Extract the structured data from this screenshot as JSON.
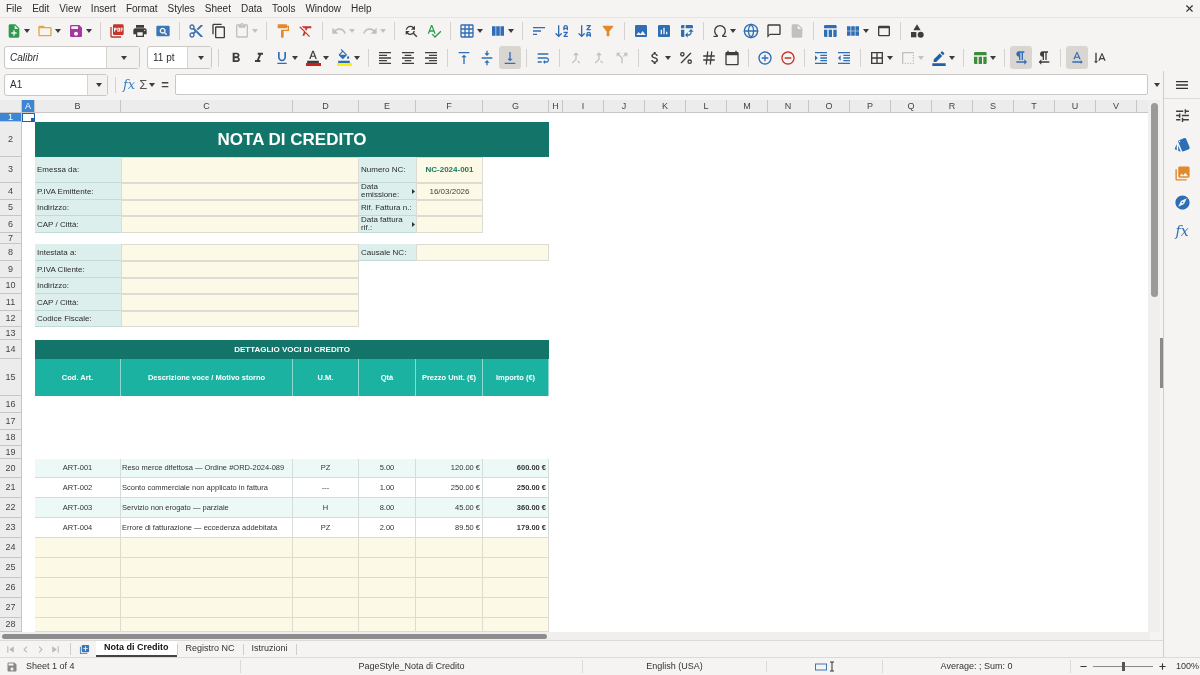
{
  "menu_bar": {
    "items": [
      "File",
      "Edit",
      "View",
      "Insert",
      "Format",
      "Styles",
      "Sheet",
      "Data",
      "Tools",
      "Window",
      "Help"
    ]
  },
  "standard_toolbar": {
    "groups": [
      [
        {
          "kind": "new",
          "disabled": false
        },
        {
          "kind": "open",
          "disabled": false
        },
        {
          "kind": "save",
          "disabled": false
        }
      ],
      [
        {
          "kind": "pdf",
          "disabled": false
        },
        {
          "kind": "print",
          "disabled": false
        },
        {
          "kind": "preview",
          "disabled": false
        }
      ],
      [
        {
          "kind": "cut",
          "disabled": false
        },
        {
          "kind": "copy",
          "disabled": false
        },
        {
          "kind": "paste",
          "disabled": true
        }
      ],
      [
        {
          "kind": "clone",
          "disabled": false
        },
        {
          "kind": "clear",
          "disabled": false
        }
      ],
      [
        {
          "kind": "undo",
          "disabled": true
        },
        {
          "kind": "redo",
          "disabled": true
        }
      ],
      [
        {
          "kind": "find",
          "disabled": false
        },
        {
          "kind": "spelling",
          "disabled": false
        }
      ],
      [
        {
          "kind": "row",
          "disabled": false
        },
        {
          "kind": "column",
          "disabled": false
        }
      ],
      [
        {
          "kind": "sort",
          "disabled": false
        },
        {
          "kind": "ascending",
          "disabled": false
        },
        {
          "kind": "descending",
          "disabled": false
        },
        {
          "kind": "autofilter",
          "disabled": false
        }
      ],
      [
        {
          "kind": "image",
          "disabled": false
        },
        {
          "kind": "chart",
          "disabled": false
        },
        {
          "kind": "pivot",
          "disabled": false
        }
      ],
      [
        {
          "kind": "special",
          "disabled": false
        },
        {
          "kind": "hyperlink",
          "disabled": false
        },
        {
          "kind": "comment",
          "disabled": false
        },
        {
          "kind": "headers",
          "disabled": true
        }
      ],
      [
        {
          "kind": "printarea",
          "disabled": false
        },
        {
          "kind": "freeze",
          "disabled": false
        },
        {
          "kind": "split",
          "disabled": false
        }
      ],
      [
        {
          "kind": "draw",
          "disabled": false
        }
      ]
    ]
  },
  "formatting_toolbar": {
    "font_name": "Calibri",
    "font_size": "11 pt",
    "groups": [
      [
        {
          "kind": "bold",
          "on": false,
          "disabled": false
        },
        {
          "kind": "italic",
          "on": false,
          "disabled": false
        },
        {
          "kind": "underline",
          "on": false,
          "disabled": false
        },
        {
          "kind": "fontcolor",
          "on": false,
          "disabled": false
        },
        {
          "kind": "highlight",
          "on": false,
          "disabled": false
        }
      ],
      [
        {
          "kind": "left",
          "on": false,
          "disabled": false
        },
        {
          "kind": "center",
          "on": false,
          "disabled": false
        },
        {
          "kind": "right",
          "on": false,
          "disabled": false
        }
      ],
      [
        {
          "kind": "top",
          "on": false,
          "disabled": false
        },
        {
          "kind": "middle",
          "on": false,
          "disabled": false
        },
        {
          "kind": "bottom",
          "on": true,
          "disabled": false
        }
      ],
      [
        {
          "kind": "wrap",
          "on": false,
          "disabled": false
        }
      ],
      [
        {
          "kind": "mergecenter",
          "on": false,
          "disabled": true
        },
        {
          "kind": "merge",
          "on": false,
          "disabled": true
        },
        {
          "kind": "unmerge",
          "on": false,
          "disabled": true
        }
      ],
      [
        {
          "kind": "currency",
          "on": false,
          "disabled": false
        },
        {
          "kind": "percent",
          "on": false,
          "disabled": false
        },
        {
          "kind": "number",
          "on": false,
          "disabled": false
        },
        {
          "kind": "date",
          "on": false,
          "disabled": false
        }
      ],
      [
        {
          "kind": "adddecimal",
          "on": false,
          "disabled": false
        },
        {
          "kind": "deletedecimal",
          "on": false,
          "disabled": false
        }
      ],
      [
        {
          "kind": "indent",
          "on": false,
          "disabled": false
        },
        {
          "kind": "outdent",
          "on": false,
          "disabled": false
        }
      ],
      [
        {
          "kind": "borders",
          "on": false,
          "disabled": false
        },
        {
          "kind": "borderstyle",
          "on": false,
          "disabled": true
        },
        {
          "kind": "bordercolor",
          "on": false,
          "disabled": false
        }
      ],
      [
        {
          "kind": "conditional",
          "on": false,
          "disabled": false
        }
      ],
      [
        {
          "kind": "ltr",
          "on": true,
          "disabled": false
        },
        {
          "kind": "rtl",
          "on": false,
          "disabled": false
        }
      ],
      [
        {
          "kind": "horizontal",
          "on": true,
          "disabled": false
        },
        {
          "kind": "vertical",
          "on": false,
          "disabled": false
        }
      ]
    ]
  },
  "formula_bar": {
    "cell_reference": "A1",
    "function_wizard": "fx",
    "sum": "Σ",
    "equals": "="
  },
  "sheet": {
    "column_headers": [
      {
        "label": "A",
        "selected": true
      },
      {
        "label": "B",
        "selected": false
      },
      {
        "label": "C",
        "selected": false
      },
      {
        "label": "D",
        "selected": false
      },
      {
        "label": "E",
        "selected": false
      },
      {
        "label": "F",
        "selected": false
      },
      {
        "label": "G",
        "selected": false
      },
      {
        "label": "H",
        "selected": false
      },
      {
        "label": "I",
        "selected": false
      },
      {
        "label": "J",
        "selected": false
      },
      {
        "label": "K",
        "selected": false
      },
      {
        "label": "L",
        "selected": false
      },
      {
        "label": "M",
        "selected": false
      },
      {
        "label": "N",
        "selected": false
      },
      {
        "label": "O",
        "selected": false
      },
      {
        "label": "P",
        "selected": false
      },
      {
        "label": "Q",
        "selected": false
      },
      {
        "label": "R",
        "selected": false
      },
      {
        "label": "S",
        "selected": false
      },
      {
        "label": "T",
        "selected": false
      },
      {
        "label": "U",
        "selected": false
      },
      {
        "label": "V",
        "selected": false
      }
    ],
    "row_headers": [
      {
        "label": "1",
        "selected": true
      },
      {
        "label": "2",
        "selected": false
      },
      {
        "label": "3",
        "selected": false
      },
      {
        "label": "4",
        "selected": false
      },
      {
        "label": "5",
        "selected": false
      },
      {
        "label": "6",
        "selected": false
      },
      {
        "label": "7",
        "selected": false
      },
      {
        "label": "8",
        "selected": false
      },
      {
        "label": "9",
        "selected": false
      },
      {
        "label": "10",
        "selected": false
      },
      {
        "label": "11",
        "selected": false
      },
      {
        "label": "12",
        "selected": false
      },
      {
        "label": "13",
        "selected": false
      },
      {
        "label": "14",
        "selected": false
      },
      {
        "label": "15",
        "selected": false
      },
      {
        "label": "16",
        "selected": false
      },
      {
        "label": "17",
        "selected": false
      },
      {
        "label": "18",
        "selected": false
      },
      {
        "label": "19",
        "selected": false
      },
      {
        "label": "20",
        "selected": false
      },
      {
        "label": "21",
        "selected": false
      },
      {
        "label": "22",
        "selected": false
      },
      {
        "label": "23",
        "selected": false
      },
      {
        "label": "24",
        "selected": false
      },
      {
        "label": "25",
        "selected": false
      },
      {
        "label": "26",
        "selected": false
      },
      {
        "label": "27",
        "selected": false
      },
      {
        "label": "28",
        "selected": false
      }
    ],
    "title": "NOTA DI CREDITO",
    "issuer_fields": [
      {
        "label": "Emessa da:"
      },
      {
        "label": "P.IVA Emittente:"
      },
      {
        "label": "Indirizzo:"
      },
      {
        "label": "CAP / Città:"
      }
    ],
    "document_fields": [
      {
        "label": "Numero NC:",
        "value": "NC-2024-001",
        "clipped": false
      },
      {
        "label": "Data emissione:",
        "value": "16/03/2026",
        "clipped": true
      },
      {
        "label": "Rif. Fattura n.:",
        "clipped": false
      },
      {
        "label": "Data fattura rif.:",
        "clipped": true
      }
    ],
    "recipient_fields": [
      {
        "label": "Intestata a:"
      },
      {
        "label": "P.IVA Cliente:"
      },
      {
        "label": "Indirizzo:"
      },
      {
        "label": "CAP / Città:"
      },
      {
        "label": "Codice Fiscale:"
      }
    ],
    "reason_field": {
      "label": "Causale NC:"
    },
    "items_table": {
      "title": "DETTAGLIO VOCI DI CREDITO",
      "columns": [
        "Cod. Art.",
        "Descrizione voce / Motivo storno",
        "U.M.",
        "Qtà",
        "Prezzo Unit. (€)",
        "Importo (€)"
      ],
      "rows": [
        {
          "kind": "item",
          "code": "ART-001",
          "description": "Reso merce difettosa — Ordine #ORD-2024-089",
          "unit": "PZ",
          "quantity": "5.00",
          "unit_price": "120.00 €",
          "amount": "600.00 €"
        },
        {
          "kind": "item",
          "code": "ART-002",
          "description": "Sconto commerciale non applicato in fattura",
          "unit": "---",
          "quantity": "1.00",
          "unit_price": "250.00 €",
          "amount": "250.00 €"
        },
        {
          "kind": "item",
          "code": "ART-003",
          "description": "Servizio non erogato — parziale",
          "unit": "H",
          "quantity": "8.00",
          "unit_price": "45.00 €",
          "amount": "360.00 €"
        },
        {
          "kind": "item",
          "code": "ART-004",
          "description": "Errore di fatturazione — eccedenza addebitata",
          "unit": "PZ",
          "quantity": "2.00",
          "unit_price": "89.50 €",
          "amount": "179.00 €"
        },
        {
          "kind": "blank"
        },
        {
          "kind": "blank"
        },
        {
          "kind": "blank"
        },
        {
          "kind": "blank"
        },
        {
          "kind": "blank"
        }
      ]
    }
  },
  "sheet_tabs": {
    "tabs": [
      {
        "label": "Nota di Credito",
        "selected": true
      },
      {
        "label": "Registro NC",
        "selected": false
      },
      {
        "label": "Istruzioni",
        "selected": false
      }
    ]
  },
  "sidebar": {
    "functions_deck": "fx"
  },
  "status_bar": {
    "sheet_position": "Sheet 1 of 4",
    "page_style": "PageStyle_Nota di Credito",
    "language": "English (USA)",
    "selection_summary": "Average: ; Sum: 0",
    "zoom": {
      "level": 0.5,
      "reading": "100%"
    }
  }
}
